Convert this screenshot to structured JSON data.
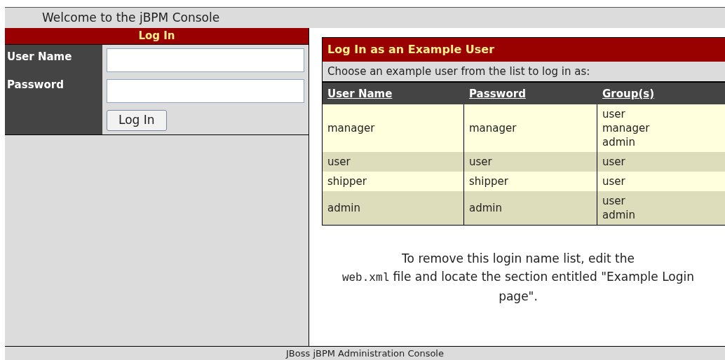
{
  "header": {
    "title": "Welcome to the jBPM Console"
  },
  "login": {
    "title": "Log In",
    "fields": [
      {
        "label": "User Name"
      },
      {
        "label": "Password"
      }
    ],
    "button": "Log In"
  },
  "examples": {
    "title": "Log In as an Example User",
    "subtitle": "Choose an example user from the list to log in as:",
    "columns": [
      "User Name",
      "Password",
      "Group(s)"
    ],
    "rows": [
      {
        "cells": [
          "manager",
          "manager",
          "user\nmanager\nadmin"
        ]
      },
      {
        "cells": [
          "user",
          "user",
          "user"
        ]
      },
      {
        "cells": [
          "shipper",
          "shipper",
          "user"
        ]
      },
      {
        "cells": [
          "admin",
          "admin",
          "user\nadmin"
        ]
      }
    ]
  },
  "note": {
    "before": "To remove this login name list, edit the",
    "code": "web.xml",
    "after": "file and locate the section entitled \"Example Login page\"."
  },
  "footer": {
    "text": "JBoss jBPM Administration Console"
  }
}
